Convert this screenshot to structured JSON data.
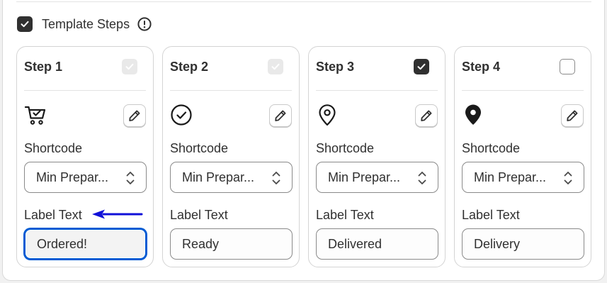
{
  "template": {
    "label": "Template Steps",
    "checked": true
  },
  "steps": [
    {
      "title": "Step 1",
      "checkbox_state": "disabled-checked",
      "icon": "cart-check-icon",
      "shortcode_label": "Shortcode",
      "shortcode_value": "Min Prepar...",
      "label_text_label": "Label Text",
      "label_text_value": "Ordered!"
    },
    {
      "title": "Step 2",
      "checkbox_state": "disabled-checked",
      "icon": "check-circle-icon",
      "shortcode_label": "Shortcode",
      "shortcode_value": "Min Prepar...",
      "label_text_label": "Label Text",
      "label_text_value": "Ready"
    },
    {
      "title": "Step 3",
      "checkbox_state": "checked",
      "icon": "location-outline-icon",
      "shortcode_label": "Shortcode",
      "shortcode_value": "Min Prepar...",
      "label_text_label": "Label Text",
      "label_text_value": "Delivered"
    },
    {
      "title": "Step 4",
      "checkbox_state": "unchecked",
      "icon": "location-filled-icon",
      "shortcode_label": "Shortcode",
      "shortcode_value": "Min Prepar...",
      "label_text_label": "Label Text",
      "label_text_value": "Delivery"
    }
  ],
  "colors": {
    "focus_ring": "#005bd3",
    "annotation_arrow": "#1010d8",
    "checkbox_checked": "#303030"
  }
}
